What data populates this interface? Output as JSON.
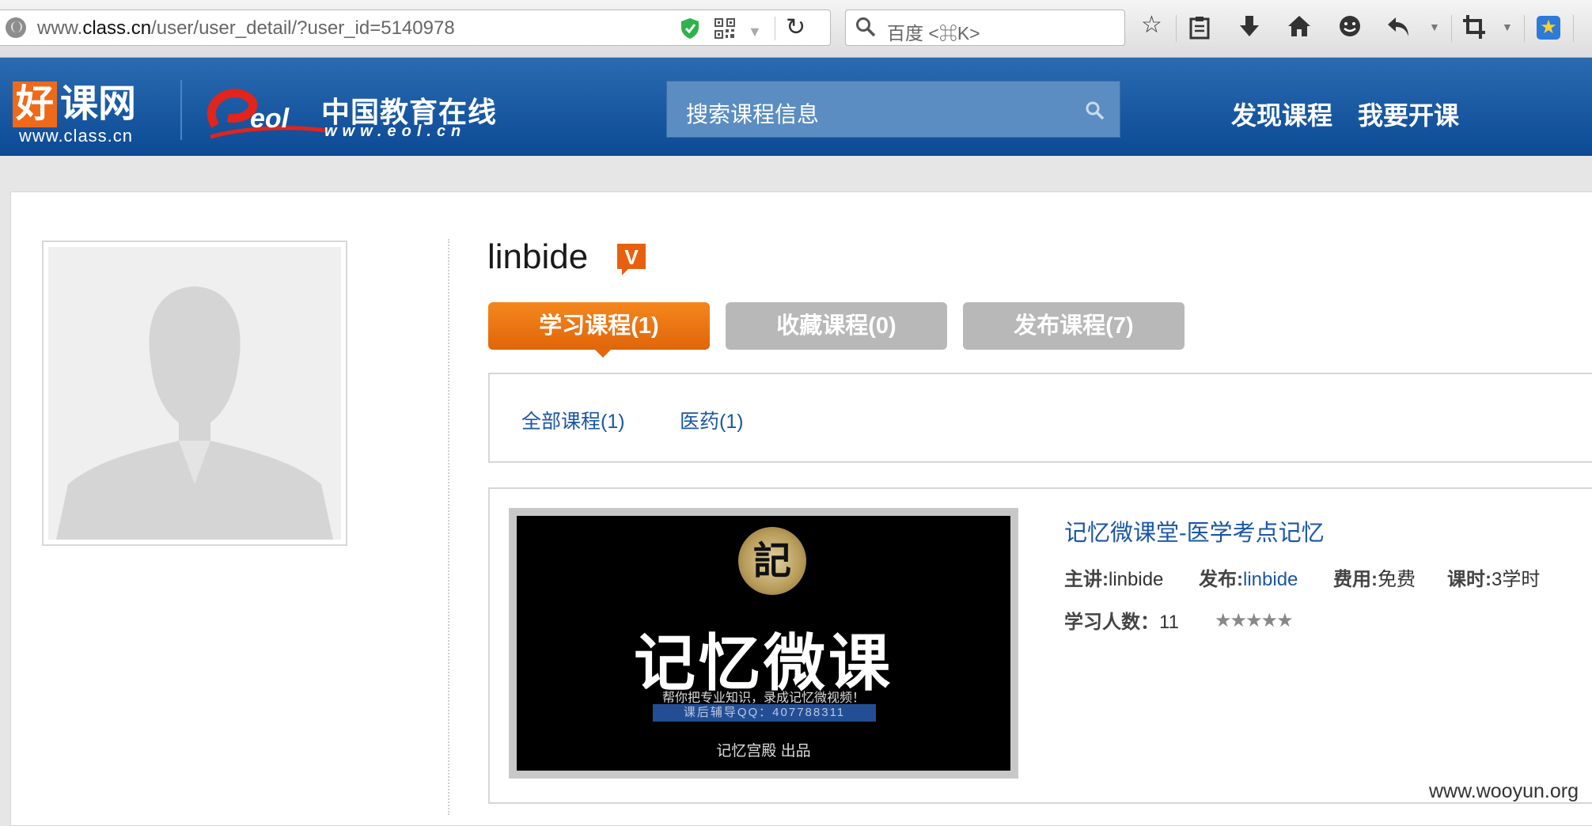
{
  "browser": {
    "url_prefix": "www.",
    "url_domain": "class.cn",
    "url_path": "/user/user_detail/?user_id=5140978",
    "search_placeholder": "百度 <⌘K>"
  },
  "site": {
    "logo_name": "好课网",
    "logo_first_char": "好",
    "logo_rest": "课网",
    "logo_url": "www.class.cn",
    "partner_mark": "eol",
    "partner_name": "中国教育在线",
    "partner_url": "www.eol.cn",
    "search_placeholder": "搜索课程信息",
    "nav": [
      "发现课程",
      "我要开课"
    ]
  },
  "profile": {
    "username": "linbide",
    "badge": "V",
    "tabs": [
      {
        "label": "学习课程(1)",
        "active": true
      },
      {
        "label": "收藏课程(0)",
        "active": false
      },
      {
        "label": "发布课程(7)",
        "active": false
      }
    ],
    "filters": [
      "全部课程(1)",
      "医药(1)"
    ]
  },
  "course": {
    "thumb_logo": "記",
    "thumb_title": "记忆微课",
    "thumb_line1": "帮你把专业知识，录成记忆微视频！",
    "thumb_line2": "课后辅导QQ：407788311",
    "thumb_footer": "记忆宫殿 出品",
    "title": "记忆微课堂-医学考点记忆",
    "lecturer_label": "主讲:",
    "lecturer": "linbide",
    "publisher_label": "发布:",
    "publisher": "linbide",
    "fee_label": "费用:",
    "fee": "免费",
    "hours_label": "课时:",
    "hours": "3学时",
    "learners_label": "学习人数：",
    "learners": "11",
    "rating": 5
  },
  "watermark": "www.wooyun.org",
  "colors": {
    "header_blue": "#1a5aa3",
    "accent_orange": "#f07a12",
    "link_blue": "#1b56a6",
    "tab_inactive": "#b8b8b8"
  }
}
